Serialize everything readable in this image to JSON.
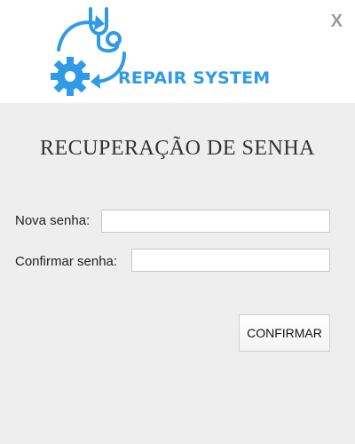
{
  "header": {
    "logo_text": "REPAIR SYSTEM",
    "close_label": "X"
  },
  "form": {
    "title": "RECUPERAÇÃO DE SENHA",
    "new_password_label": "Nova senha:",
    "new_password_value": "",
    "confirm_password_label": "Confirmar senha:",
    "confirm_password_value": "",
    "confirm_button_label": "CONFIRMAR"
  },
  "colors": {
    "brand": "#2f9be6",
    "content_background": "#eeeeee",
    "close_icon": "#9a9a9a"
  },
  "icons": {
    "logo": "stethoscope-gear-cycle-icon"
  }
}
